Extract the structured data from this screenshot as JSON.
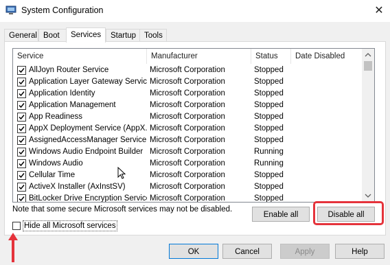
{
  "window": {
    "title": "System Configuration",
    "close_glyph": "✕"
  },
  "tabs": [
    {
      "label": "General"
    },
    {
      "label": "Boot"
    },
    {
      "label": "Services",
      "selected": true
    },
    {
      "label": "Startup"
    },
    {
      "label": "Tools"
    }
  ],
  "table": {
    "columns": [
      "Service",
      "Manufacturer",
      "Status",
      "Date Disabled"
    ],
    "rows": [
      {
        "checked": true,
        "service": "AllJoyn Router Service",
        "manufacturer": "Microsoft Corporation",
        "status": "Stopped"
      },
      {
        "checked": true,
        "service": "Application Layer Gateway Service",
        "manufacturer": "Microsoft Corporation",
        "status": "Stopped"
      },
      {
        "checked": true,
        "service": "Application Identity",
        "manufacturer": "Microsoft Corporation",
        "status": "Stopped"
      },
      {
        "checked": true,
        "service": "Application Management",
        "manufacturer": "Microsoft Corporation",
        "status": "Stopped"
      },
      {
        "checked": true,
        "service": "App Readiness",
        "manufacturer": "Microsoft Corporation",
        "status": "Stopped"
      },
      {
        "checked": true,
        "service": "AppX Deployment Service (AppX...",
        "manufacturer": "Microsoft Corporation",
        "status": "Stopped"
      },
      {
        "checked": true,
        "service": "AssignedAccessManager Service",
        "manufacturer": "Microsoft Corporation",
        "status": "Stopped"
      },
      {
        "checked": true,
        "service": "Windows Audio Endpoint Builder",
        "manufacturer": "Microsoft Corporation",
        "status": "Running"
      },
      {
        "checked": true,
        "service": "Windows Audio",
        "manufacturer": "Microsoft Corporation",
        "status": "Running"
      },
      {
        "checked": true,
        "service": "Cellular Time",
        "manufacturer": "Microsoft Corporation",
        "status": "Stopped"
      },
      {
        "checked": true,
        "service": "ActiveX Installer (AxInstSV)",
        "manufacturer": "Microsoft Corporation",
        "status": "Stopped"
      },
      {
        "checked": true,
        "service": "BitLocker Drive Encryption Service",
        "manufacturer": "Microsoft Corporation",
        "status": "Stopped"
      }
    ]
  },
  "note": "Note that some secure Microsoft services may not be disabled.",
  "buttons": {
    "enable_all": "Enable all",
    "disable_all": "Disable all",
    "ok": "OK",
    "cancel": "Cancel",
    "apply": "Apply",
    "help": "Help"
  },
  "hide_ms_services": {
    "label": "Hide all Microsoft services",
    "checked": false
  },
  "colors": {
    "highlight": "#e5333b",
    "accent": "#0078d7"
  }
}
